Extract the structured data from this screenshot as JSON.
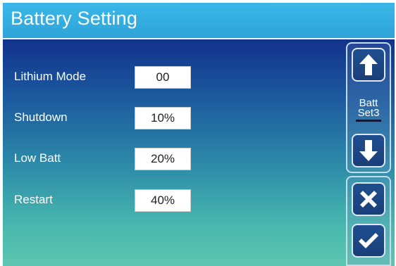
{
  "header": {
    "title": "Battery Setting"
  },
  "settings": [
    {
      "label": "Lithium Mode",
      "value": "00"
    },
    {
      "label": "Shutdown",
      "value": "10%"
    },
    {
      "label": "Low Batt",
      "value": "20%"
    },
    {
      "label": "Restart",
      "value": "40%"
    }
  ],
  "sidebar": {
    "page_label_line1": "Batt",
    "page_label_line2": "Set3",
    "icons": {
      "up": "arrow-up-icon",
      "down": "arrow-down-icon",
      "cancel": "close-icon",
      "confirm": "checkmark-icon"
    }
  },
  "colors": {
    "title_bar": "#2ea4d8",
    "panel_top": "#12328c",
    "panel_bottom": "#5ec6b0",
    "button_fill": "#1a3f7a"
  }
}
